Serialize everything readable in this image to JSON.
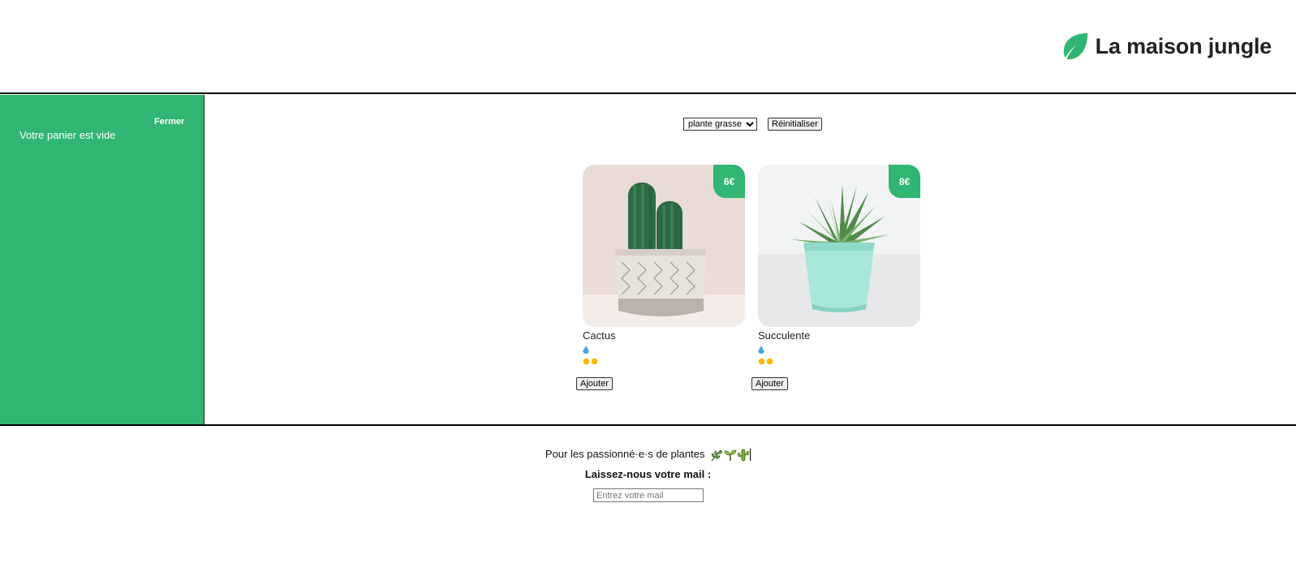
{
  "header": {
    "logo_icon": "leaf-icon",
    "title": "La maison jungle"
  },
  "cart": {
    "close_label": "Fermer",
    "empty_text": "Votre panier est vide",
    "background_color": "#31b572"
  },
  "filters": {
    "selected_category": "plante grasse",
    "reset_label": "Réinitialiser"
  },
  "plants": [
    {
      "name": "Cactus",
      "price": "6€",
      "water_icons": [
        "water-drop-icon"
      ],
      "light_icons": [
        "sun-icon",
        "sun-icon"
      ],
      "add_label": "Ajouter"
    },
    {
      "name": "Succulente",
      "price": "8€",
      "water_icons": [
        "water-drop-icon"
      ],
      "light_icons": [
        "sun-icon",
        "sun-icon"
      ],
      "add_label": "Ajouter"
    }
  ],
  "footer": {
    "tagline": "Pour les passionné·e·s de plantes",
    "tagline_icons": [
      "herb-icon",
      "seedling-icon",
      "cactus-icon"
    ],
    "mail_prompt": "Laissez-nous votre mail :",
    "mail_placeholder": "Entrez votre mail",
    "mail_value": ""
  },
  "colors": {
    "accent": "#31b572",
    "water": "#4aa3df",
    "sun": "#f5b800"
  }
}
